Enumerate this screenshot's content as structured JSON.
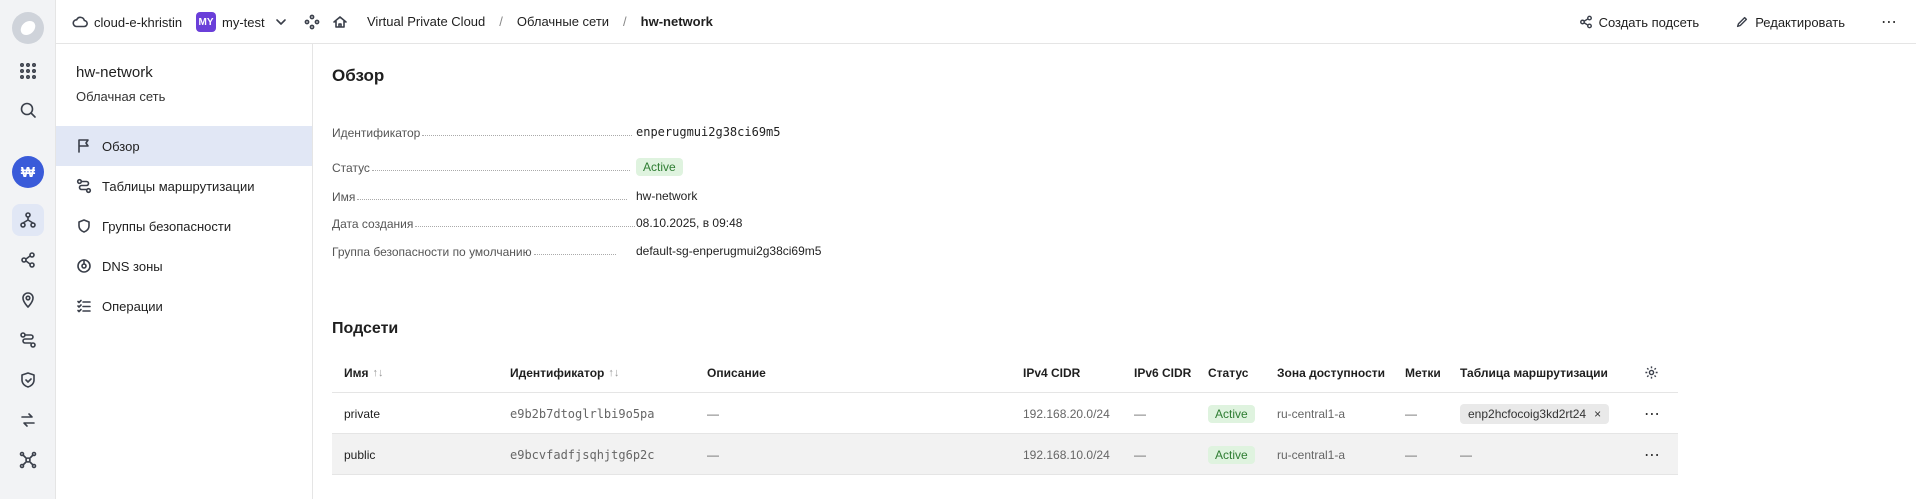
{
  "topbar": {
    "cloud": "cloud-e-khristin",
    "folder_badge": "MY",
    "folder": "my-test",
    "breadcrumb": [
      "Virtual Private Cloud",
      "Облачные сети",
      "hw-network"
    ],
    "separator": "/",
    "create_subnet": "Создать подсеть",
    "edit": "Редактировать",
    "more": "⋯"
  },
  "rail": {
    "user_initial": "₩"
  },
  "nav": {
    "title": "hw-network",
    "subtitle": "Облачная сеть",
    "items": [
      {
        "label": "Обзор",
        "icon": "flag-icon"
      },
      {
        "label": "Таблицы маршрутизации",
        "icon": "route-icon"
      },
      {
        "label": "Группы безопасности",
        "icon": "shield-icon"
      },
      {
        "label": "DNS зоны",
        "icon": "dns-icon"
      },
      {
        "label": "Операции",
        "icon": "list-icon"
      }
    ]
  },
  "overview": {
    "heading": "Обзор",
    "fields": [
      {
        "label": "Идентификатор",
        "value": "enperugmui2g38ci69m5"
      },
      {
        "label": "Статус",
        "value": "Active"
      },
      {
        "label": "Имя",
        "value": "hw-network"
      },
      {
        "label": "Дата создания",
        "value": "08.10.2025, в 09:48"
      },
      {
        "label": "Группа безопасности по умолчанию",
        "value": "default-sg-enperugmui2g38ci69m5"
      }
    ]
  },
  "subnets": {
    "heading": "Подсети",
    "columns": [
      "Имя",
      "Идентификатор",
      "Описание",
      "IPv4 CIDR",
      "IPv6 CIDR",
      "Статус",
      "Зона доступности",
      "Метки",
      "Таблица маршрутизации"
    ],
    "sort_glyph": "↑↓",
    "rows": [
      {
        "name": "private",
        "id": "e9b2b7dtoglrlbi9o5pa",
        "description": "—",
        "ipv4": "192.168.20.0/24",
        "ipv6": "—",
        "status": "Active",
        "zone": "ru-central1-a",
        "labels": "—",
        "route_table": "enp2hcfocoig3kd2rt24",
        "remove": "×",
        "more": "⋯"
      },
      {
        "name": "public",
        "id": "e9bcvfadfjsqhjtg6p2c",
        "description": "—",
        "ipv4": "192.168.10.0/24",
        "ipv6": "—",
        "status": "Active",
        "zone": "ru-central1-a",
        "labels": "—",
        "route_table": "—",
        "more": "⋯"
      }
    ]
  },
  "colors": {
    "accent": "#2d63c8",
    "active_bg": "#dff3df",
    "active_text": "#2e7d32",
    "selected_nav": "#e1e7f5",
    "folder_badge": "#6a3fd9"
  }
}
